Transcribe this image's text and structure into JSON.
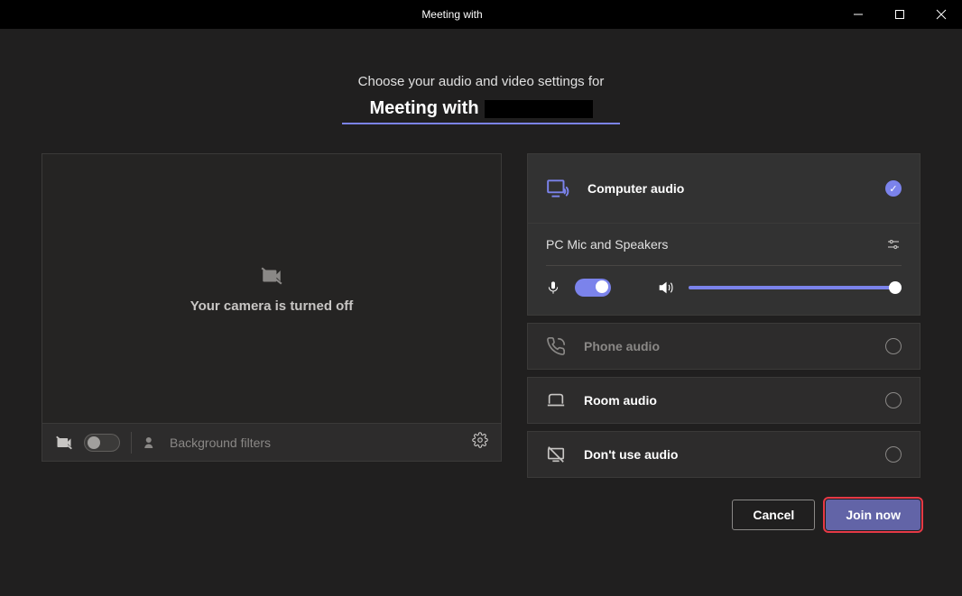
{
  "window": {
    "title_prefix": "Meeting with"
  },
  "header": {
    "prompt": "Choose your audio and video settings for",
    "meeting_title_prefix": "Meeting with"
  },
  "video": {
    "camera_off_text": "Your camera is turned off",
    "background_filters_label": "Background filters"
  },
  "audio": {
    "computer_audio": "Computer audio",
    "device": "PC Mic and Speakers",
    "phone_audio": "Phone audio",
    "room_audio": "Room audio",
    "no_audio": "Don't use audio",
    "volume_percent": 100
  },
  "actions": {
    "cancel": "Cancel",
    "join": "Join now"
  },
  "colors": {
    "accent": "#7b83eb",
    "button_primary": "#6264a7"
  }
}
